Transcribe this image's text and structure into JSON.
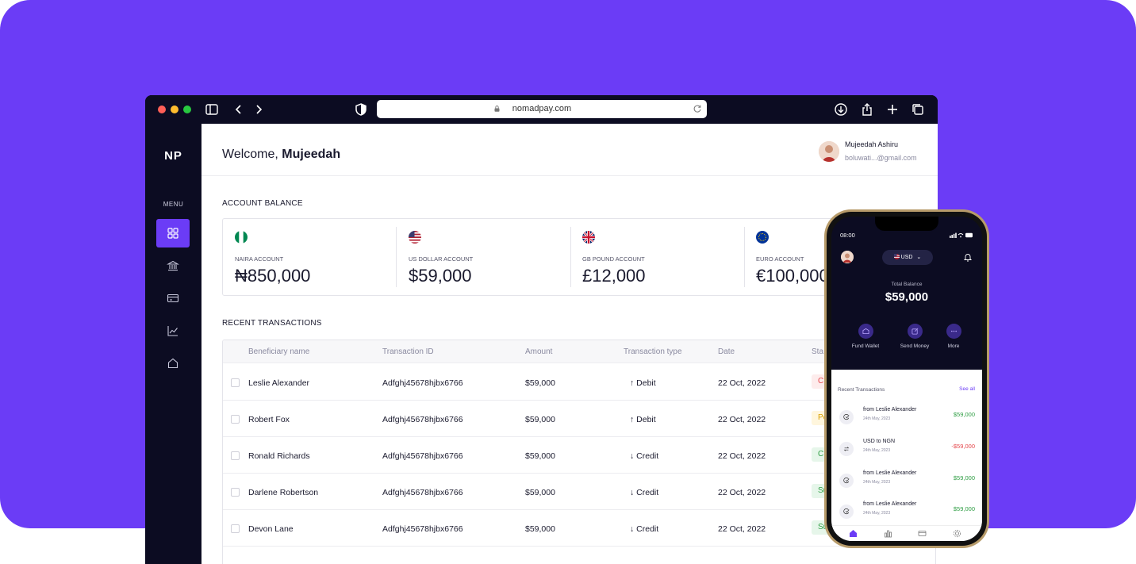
{
  "browser": {
    "url": "nomadpay.com",
    "traffic_colors": [
      "#ff5f57",
      "#febc2e",
      "#28c840"
    ]
  },
  "brand": {
    "logo": "NP",
    "accent": "#6b3cf6",
    "dark": "#0c0c22"
  },
  "sidebar": {
    "menu_label": "MENU",
    "items": [
      {
        "icon": "grid-icon",
        "active": true
      },
      {
        "icon": "bank-icon",
        "active": false
      },
      {
        "icon": "card-icon",
        "active": false
      },
      {
        "icon": "chart-icon",
        "active": false
      },
      {
        "icon": "home-icon",
        "active": false
      }
    ]
  },
  "header": {
    "welcome": "Welcome,",
    "user_first": "Mujeedah",
    "user_name": "Mujeedah Ashiru",
    "user_email": "boluwati...@gmail.com"
  },
  "balance": {
    "title": "ACCOUNT BALANCE",
    "accounts": [
      {
        "label": "NAIRA ACCOUNT",
        "amount": "₦850,000",
        "flag": "ng-flag-icon"
      },
      {
        "label": "US DOLLAR ACCOUNT",
        "amount": "$59,000",
        "flag": "us-flag-icon"
      },
      {
        "label": "GB POUND ACCOUNT",
        "amount": "£12,000",
        "flag": "gb-flag-icon"
      },
      {
        "label": "EURO ACCOUNT",
        "amount": "€100,000",
        "flag": "eu-flag-icon"
      }
    ]
  },
  "transactions": {
    "title": "RECENT TRANSACTIONS",
    "columns": [
      "Beneficiary name",
      "Transaction ID",
      "Amount",
      "Transaction type",
      "Date",
      "Sta"
    ],
    "rows": [
      {
        "name": "Leslie Alexander",
        "id": "Adfghj45678hjbx6766",
        "amount": "$59,000",
        "type": "↑ Debit",
        "date": "22 Oct, 2022",
        "status": "C",
        "status_color": "#e5484d",
        "status_bg": "#fdecec"
      },
      {
        "name": "Robert Fox",
        "id": "Adfghj45678hjbx6766",
        "amount": "$59,000",
        "type": "↑ Debit",
        "date": "22 Oct, 2022",
        "status": "Pe",
        "status_color": "#d9a000",
        "status_bg": "#fff6dd"
      },
      {
        "name": "Ronald Richards",
        "id": "Adfghj45678hjbx6766",
        "amount": "$59,000",
        "type": "↓ Credit",
        "date": "22 Oct, 2022",
        "status": "C",
        "status_color": "#2f9e44",
        "status_bg": "#e6f6ea"
      },
      {
        "name": "Darlene Robertson",
        "id": "Adfghj45678hjbx6766",
        "amount": "$59,000",
        "type": "↓ Credit",
        "date": "22 Oct, 2022",
        "status": "Su",
        "status_color": "#2f9e44",
        "status_bg": "#e6f6ea"
      },
      {
        "name": "Devon Lane",
        "id": "Adfghj45678hjbx6766",
        "amount": "$59,000",
        "type": "↓ Credit",
        "date": "22 Oct, 2022",
        "status": "Su",
        "status_color": "#2f9e44",
        "status_bg": "#e6f6ea"
      }
    ]
  },
  "phone": {
    "time": "08:00",
    "currency": "USD",
    "total_label": "Total Balance",
    "total": "$59,000",
    "actions": [
      "Fund Wallet",
      "Send Money",
      "More"
    ],
    "recent_label": "Recent Transactions",
    "see_all": "See all",
    "items": [
      {
        "name": "from Leslie Alexander",
        "date": "24th May, 2023",
        "amount": "$59,000",
        "color": "#2f9e44",
        "icon": "receive-icon"
      },
      {
        "name": "USD to NGN",
        "date": "24th May, 2023",
        "amount": "-$59,000",
        "color": "#e5484d",
        "icon": "exchange-icon"
      },
      {
        "name": "from Leslie Alexander",
        "date": "24th May, 2023",
        "amount": "$59,000",
        "color": "#2f9e44",
        "icon": "receive-icon"
      },
      {
        "name": "from Leslie Alexander",
        "date": "24th May, 2023",
        "amount": "$59,000",
        "color": "#2f9e44",
        "icon": "receive-icon"
      }
    ]
  }
}
